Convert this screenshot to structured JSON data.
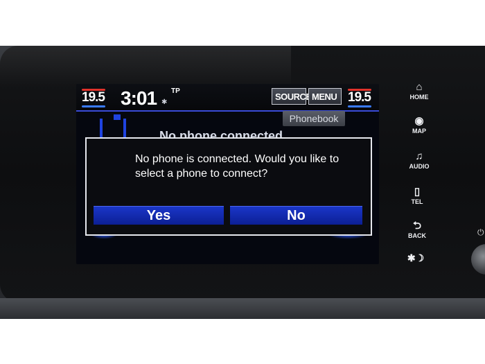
{
  "status_bar": {
    "temp_left": "19.5",
    "clock": "3:01",
    "tp": "TP",
    "source_label": "SOURCE",
    "menu_label": "MENU",
    "temp_right": "19.5"
  },
  "phone_screen": {
    "phonebook_label": "Phonebook",
    "status_text": "No phone connected"
  },
  "dialog": {
    "message": "No phone is connected. Would you like to select a phone to connect?",
    "yes_label": "Yes",
    "no_label": "No"
  },
  "side_buttons": [
    {
      "label": "HOME",
      "icon": "home-icon"
    },
    {
      "label": "MAP",
      "icon": "map-icon"
    },
    {
      "label": "AUDIO",
      "icon": "music-note-icon"
    },
    {
      "label": "TEL",
      "icon": "phone-icon"
    },
    {
      "label": "BACK",
      "icon": "back-arrow-icon"
    },
    {
      "label": "",
      "icon": "day-night-icon"
    }
  ],
  "colors": {
    "accent_blue": "#1a36c8",
    "screen_bg": "#05070f",
    "temp_hot": "#e0322a",
    "temp_cold": "#3a7bff"
  }
}
